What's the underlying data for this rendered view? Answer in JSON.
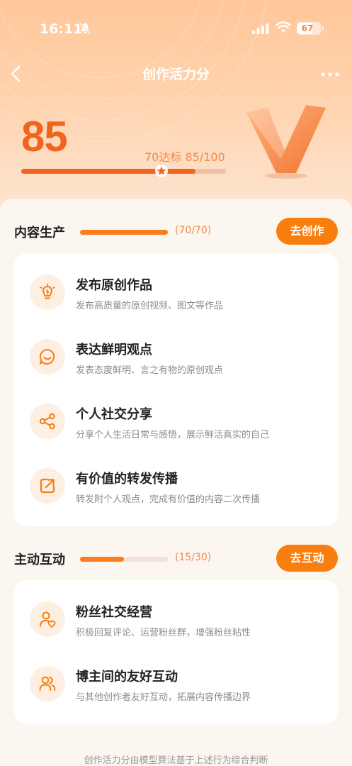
{
  "status_bar": {
    "time": "16:11",
    "battery": "67",
    "battery_level": 0.67
  },
  "nav": {
    "title": "创作活力分"
  },
  "score": {
    "value": "85",
    "target_text": "70达标 85/100",
    "progress": 0.85,
    "threshold": 0.7
  },
  "sections": [
    {
      "title": "内容生产",
      "count": "(70/70)",
      "progress": 1.0,
      "button": "去创作",
      "items": [
        {
          "icon": "bulb-icon",
          "title": "发布原创作品",
          "desc": "发布高质量的原创视频、图文等作品"
        },
        {
          "icon": "smile-icon",
          "title": "表达鲜明观点",
          "desc": "发表态度鲜明、言之有物的原创观点"
        },
        {
          "icon": "share-icon",
          "title": "个人社交分享",
          "desc": "分享个人生活日常与感悟，展示鲜活真实的自己"
        },
        {
          "icon": "forward-icon",
          "title": "有价值的转发传播",
          "desc": "转发附个人观点，完成有价值的内容二次传播"
        }
      ]
    },
    {
      "title": "主动互动",
      "count": "(15/30)",
      "progress": 0.5,
      "button": "去互动",
      "items": [
        {
          "icon": "fan-heart-icon",
          "title": "粉丝社交经营",
          "desc": "积极回复评论、运营粉丝群，增强粉丝粘性"
        },
        {
          "icon": "users-icon",
          "title": "博主间的友好互动",
          "desc": "与其他创作者友好互动，拓展内容传播边界"
        }
      ]
    }
  ],
  "footer": {
    "note": "创作活力分由模型算法基于上述行为综合判断"
  },
  "colors": {
    "accent": "#f87e10",
    "score": "#f0641e",
    "icon_bg": "#fdefe2"
  }
}
